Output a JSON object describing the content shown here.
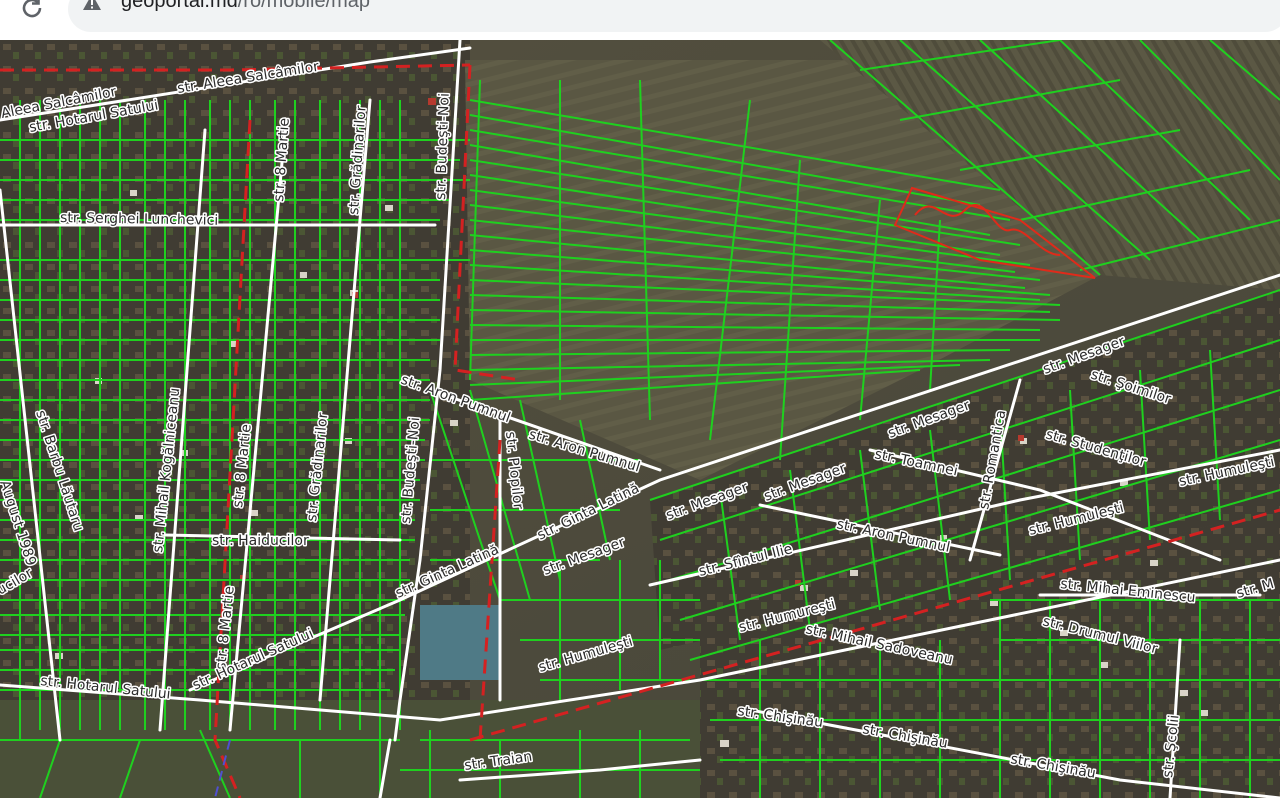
{
  "browser": {
    "url_host": "geoportal.md",
    "url_path": "/ro/mobile/map",
    "icons": [
      "reload-icon",
      "warning-icon"
    ]
  },
  "map": {
    "streets": [
      "str. Aleea Salcâmilor",
      "Aleea Salcâmilor",
      "str. Hotarul Satului",
      "str. Budeşti-Noi",
      "str. Grădinarilor",
      "str. 8 Martie",
      "str. Serghei Lunchevici",
      "str. Barbu Lăutaru",
      "August 1989",
      "ucilor",
      "str. Mihail Kogălniceanu",
      "str. 8 Martie",
      "str. Grădinarilor",
      "str. Budeşti-Noi",
      "str. Haiducilor",
      "str. 8 Martie",
      "str. Hotarul Satului",
      "str. Hotarul Satului",
      "str. Aron Pumnul",
      "str. Aron Pumnul",
      "str. Plopilor",
      "str. Ginta Latină",
      "str. Ginta Latină",
      "str. Mesager",
      "str. Mesager",
      "str. Mesager",
      "str. Mesager",
      "str. Mesager",
      "str. Şoimilor",
      "str. Studenţilor",
      "str. Toamnei",
      "str. Romantica",
      "str. Humuleşti",
      "str. Humuleşti",
      "str. Aron Pumnul",
      "str. Sfîntul Ilie",
      "str. Humureşti",
      "str. Humuleşti",
      "str. Mihai Eminescu",
      "str. Drumul Viilor",
      "str. Mihail Sadoveanu",
      "str. Chişinău",
      "str. Chişinău",
      "str. Chişinău",
      "str. Traian",
      "str. Şcolii",
      "str. M"
    ],
    "colors": {
      "parcel": "#1fd01f",
      "road": "#ffffff",
      "boundary": "#d42121",
      "highlight": "#e02a1a",
      "imagery_dark": "#4b4a3e",
      "imagery_field": "#5c5a45"
    }
  }
}
